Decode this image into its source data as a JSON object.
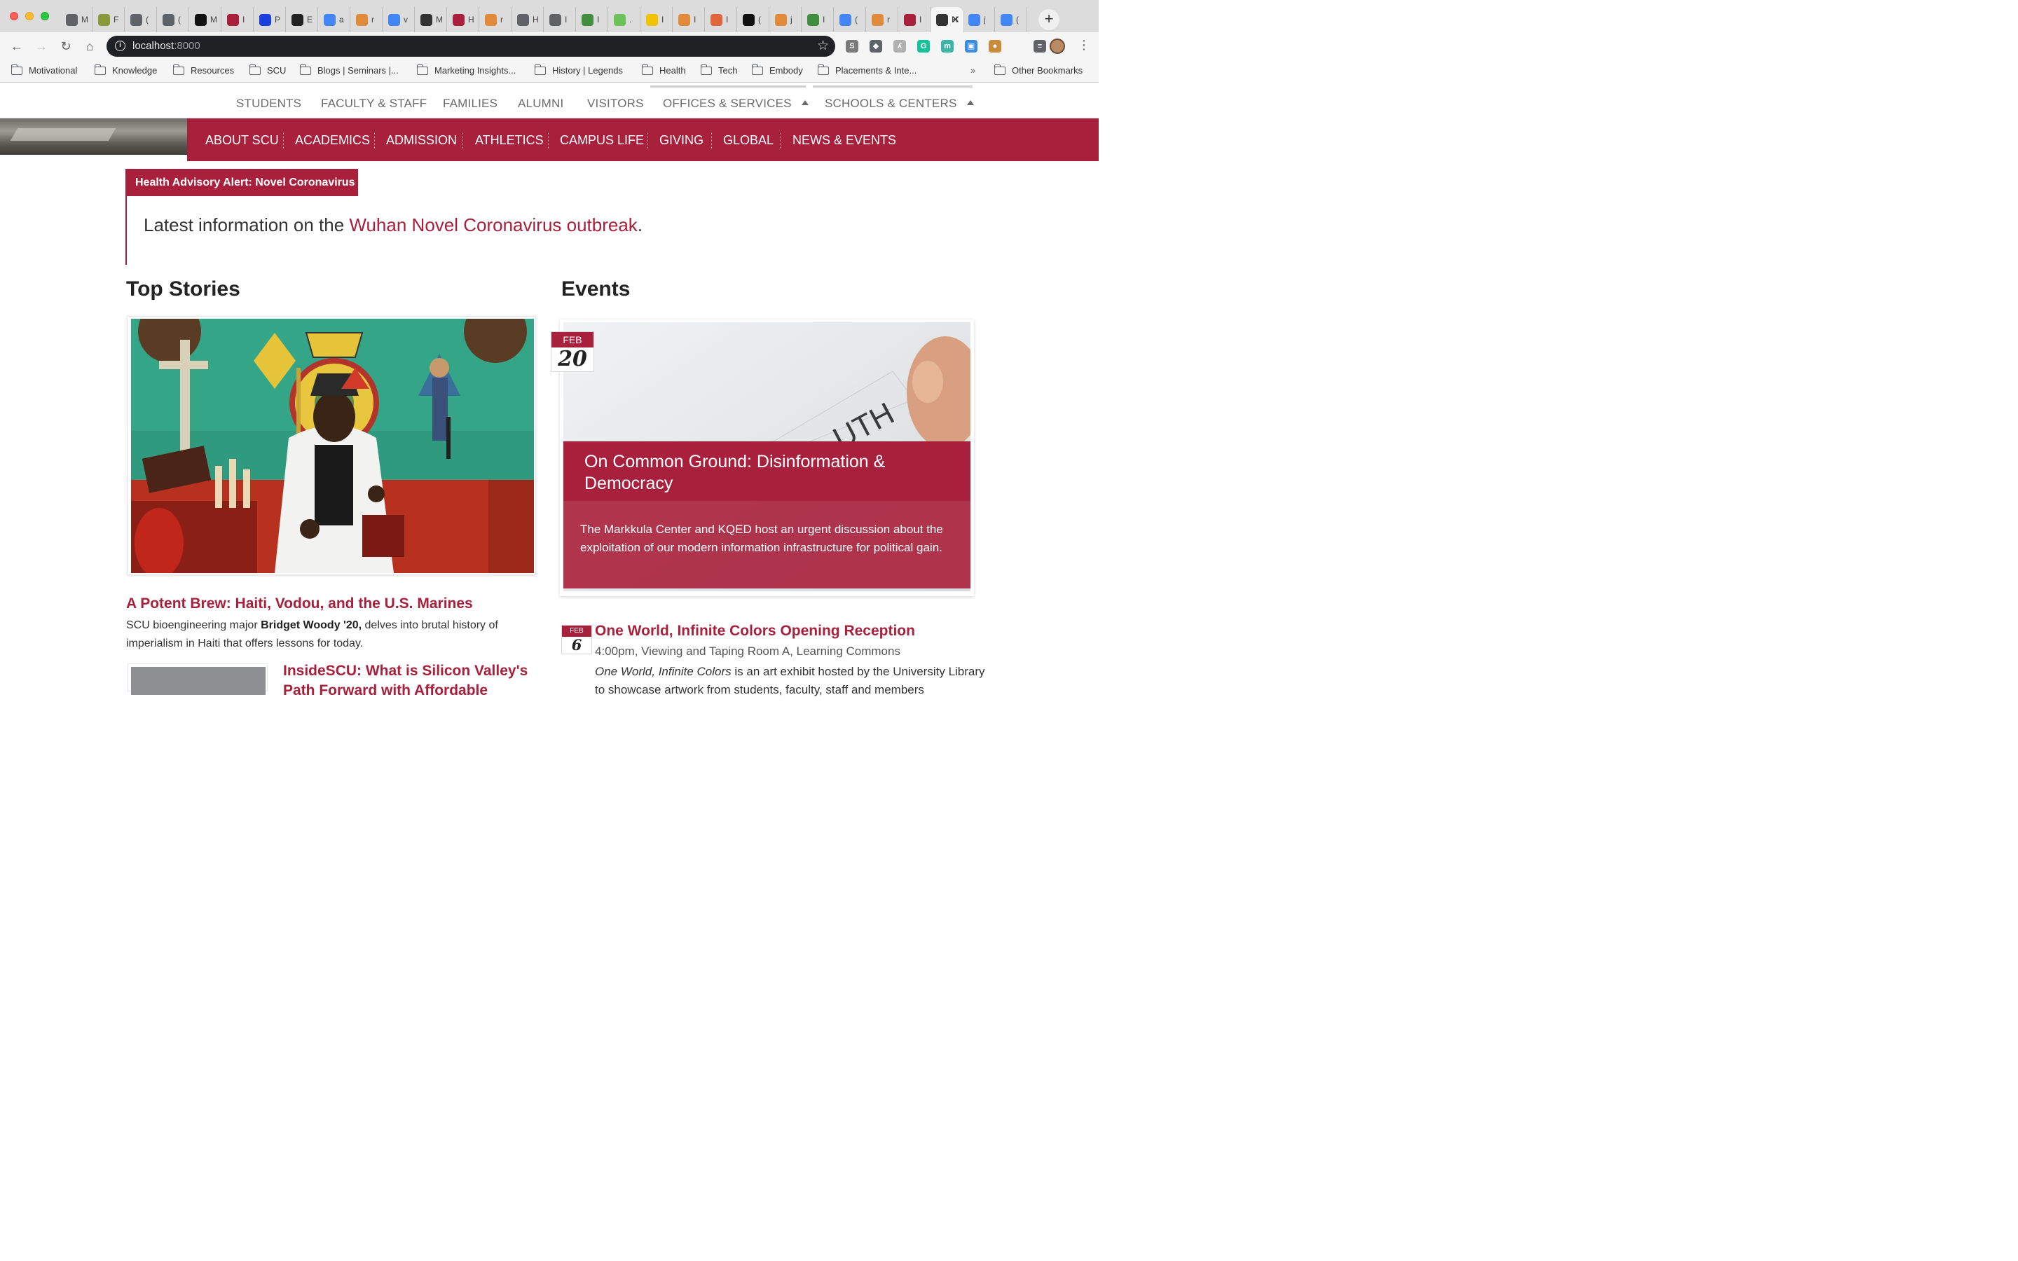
{
  "browser": {
    "tabs": [
      {
        "icon": "globe-icon",
        "label": "M",
        "color": "#5f6368"
      },
      {
        "icon": "c-icon",
        "label": "F",
        "color": "#8a9a3a"
      },
      {
        "icon": "globe-icon",
        "label": "(",
        "color": "#5f6368"
      },
      {
        "icon": "globe-icon",
        "label": "(",
        "color": "#5f6368"
      },
      {
        "icon": "d-icon",
        "label": "M",
        "color": "#111111"
      },
      {
        "icon": "scu-icon",
        "label": "I",
        "color": "#a8203b"
      },
      {
        "icon": "flag-icon",
        "label": "P",
        "color": "#1a3fe0"
      },
      {
        "icon": "ex-icon",
        "label": "E",
        "color": "#222222"
      },
      {
        "icon": "google-icon",
        "label": "a",
        "color": "#4285f4"
      },
      {
        "icon": "fox-icon",
        "label": "r",
        "color": "#e08a3a"
      },
      {
        "icon": "google-icon",
        "label": "v",
        "color": "#4285f4"
      },
      {
        "icon": "ball-icon",
        "label": "M",
        "color": "#333333"
      },
      {
        "icon": "scu-icon",
        "label": "H",
        "color": "#a8203b"
      },
      {
        "icon": "fox-icon",
        "label": "r",
        "color": "#e08a3a"
      },
      {
        "icon": "globe-icon",
        "label": "H",
        "color": "#5f6368"
      },
      {
        "icon": "globe-icon",
        "label": "I",
        "color": "#5f6368"
      },
      {
        "icon": "leaf-icon",
        "label": "I",
        "color": "#3f8f3f"
      },
      {
        "icon": "three-icon",
        "label": ".",
        "color": "#6ac259"
      },
      {
        "icon": "l-icon",
        "label": "I",
        "color": "#f2c200"
      },
      {
        "icon": "fox-icon",
        "label": "I",
        "color": "#e08a3a"
      },
      {
        "icon": "ask-icon",
        "label": "I",
        "color": "#e0653a"
      },
      {
        "icon": "github-icon",
        "label": "(",
        "color": "#111111"
      },
      {
        "icon": "fox-icon",
        "label": "j",
        "color": "#e08a3a"
      },
      {
        "icon": "leaf-icon",
        "label": "I",
        "color": "#3f8f3f"
      },
      {
        "icon": "google-icon",
        "label": "(",
        "color": "#4285f4"
      },
      {
        "icon": "fox-icon",
        "label": "r",
        "color": "#e08a3a"
      },
      {
        "icon": "scu-icon",
        "label": "I",
        "color": "#a8203b"
      },
      {
        "icon": "h-icon",
        "label": "H",
        "color": "#333333",
        "active": true
      },
      {
        "icon": "google-icon",
        "label": "j",
        "color": "#4285f4"
      },
      {
        "icon": "google-icon",
        "label": "(",
        "color": "#4285f4"
      }
    ],
    "url_host": "localhost",
    "url_port": ":8000",
    "extensions": [
      {
        "icon": "s-icon",
        "label": "S",
        "color": "#7a7a7a"
      },
      {
        "icon": "bulb-icon",
        "label": "◆",
        "color": "#5f6368"
      },
      {
        "icon": "rabbit-icon",
        "label": "ʎ",
        "color": "#b0b0b0"
      },
      {
        "icon": "grammarly-icon",
        "label": "G",
        "color": "#15c39a"
      },
      {
        "icon": "m-icon",
        "label": "m",
        "color": "#3cb4a8"
      },
      {
        "icon": "box-icon",
        "label": "▣",
        "color": "#3a8de0"
      },
      {
        "icon": "cookie-icon",
        "label": "●",
        "color": "#c98a3a"
      },
      {
        "icon": "playlist-icon",
        "label": "≡",
        "color": "#5f6368"
      }
    ],
    "bookmarks": [
      "Motivational",
      "Knowledge",
      "Resources",
      "SCU",
      "Blogs | Seminars |...",
      "Marketing Insights...",
      "History | Legends",
      "Health",
      "Tech",
      "Embody",
      "Placements & Inte..."
    ],
    "other_bookmarks": "Other Bookmarks",
    "bookmarks_more": "»"
  },
  "site": {
    "audience_nav": [
      "STUDENTS",
      "FACULTY & STAFF",
      "FAMILIES",
      "ALUMNI",
      "VISITORS",
      "OFFICES & SERVICES",
      "SCHOOLS & CENTERS"
    ],
    "main_nav": [
      "ABOUT SCU",
      "ACADEMICS",
      "ADMISSION",
      "ATHLETICS",
      "CAMPUS LIFE",
      "GIVING",
      "GLOBAL",
      "NEWS & EVENTS"
    ],
    "accent_color": "#a8203b",
    "alert": {
      "tag": "Health Advisory Alert: Novel Coronavirus",
      "text_before": "Latest information on the ",
      "link": "Wuhan Novel Coronavirus outbreak",
      "text_after": "."
    },
    "top_stories": {
      "heading": "Top Stories",
      "featured": {
        "title": "A Potent Brew: Haiti, Vodou, and the U.S. Marines",
        "desc_before": "SCU bioengineering major ",
        "desc_bold": "Bridget Woody '20,",
        "desc_after": " delves into brutal history of imperialism in Haiti that offers lessons for today."
      },
      "second": {
        "title": "InsideSCU: What is Silicon Valley's Path Forward with Affordable"
      }
    },
    "events": {
      "heading": "Events",
      "featured": {
        "month": "FEB",
        "day": "20",
        "title": "On Common Ground: Disinformation & Democracy",
        "desc": "The Markkula Center and KQED host an urgent discussion about the exploitation of our modern information infrastructure for political gain."
      },
      "second": {
        "month": "FEB",
        "day": "6",
        "title": "One World, Infinite Colors Opening Reception",
        "meta": "4:00pm, Viewing and Taping Room A, Learning Commons",
        "desc_italic": "One World, Infinite Colors",
        "desc_after": " is an art exhibit hosted by the University Library to showcase artwork from students, faculty, staff and members"
      }
    }
  }
}
